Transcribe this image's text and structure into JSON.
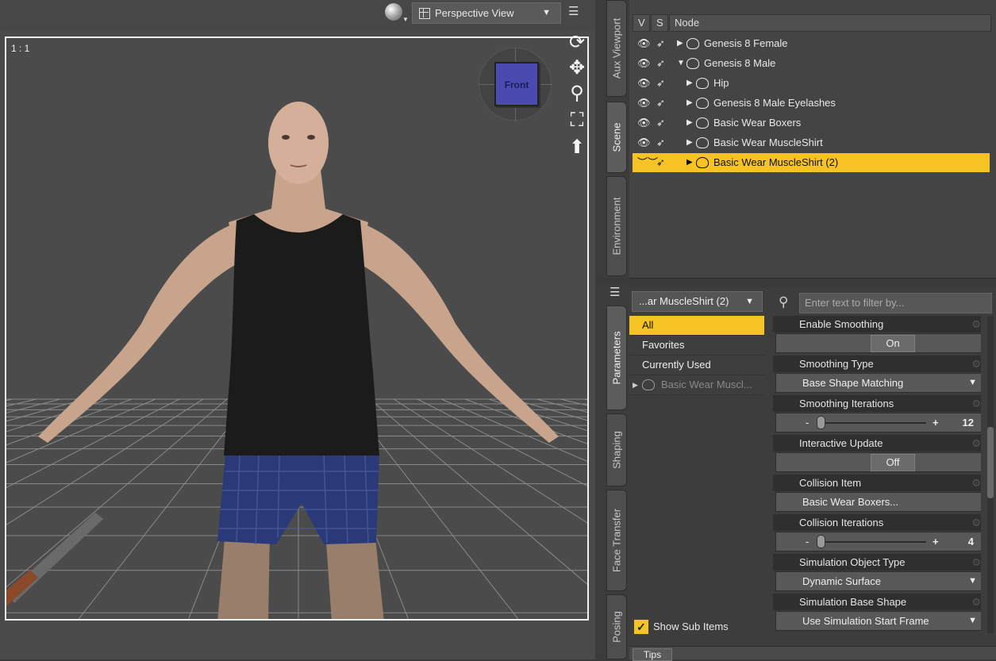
{
  "viewport": {
    "view_label": "Perspective View",
    "ratio_label": "1 : 1",
    "navcube_face": "Front",
    "tools": [
      "orbit-icon",
      "pan-icon",
      "zoom-icon",
      "frame-icon",
      "up-arrow-icon"
    ]
  },
  "side_tabs_top": [
    "Aux Viewport",
    "Scene",
    "Environment"
  ],
  "side_tabs_bottom": [
    "Parameters",
    "Shaping",
    "Face Transfer",
    "Posing"
  ],
  "scene": {
    "headers": {
      "v": "V",
      "s": "S",
      "node": "Node"
    },
    "nodes": [
      {
        "label": "Genesis 8 Female",
        "expander": "▶",
        "selected": false
      },
      {
        "label": "Genesis 8 Male",
        "expander": "▼",
        "selected": false
      },
      {
        "label": "Hip",
        "expander": "▶",
        "selected": false
      },
      {
        "label": "Genesis 8 Male Eyelashes",
        "expander": "▶",
        "selected": false
      },
      {
        "label": "Basic Wear Boxers",
        "expander": "▶",
        "selected": false
      },
      {
        "label": "Basic Wear MuscleShirt",
        "expander": "▶",
        "selected": false
      },
      {
        "label": "Basic Wear MuscleShirt (2)",
        "expander": "▶",
        "selected": true
      }
    ]
  },
  "params": {
    "node_select": "...ar MuscleShirt (2)",
    "search_placeholder": "Enter text to filter by...",
    "categories": [
      "All",
      "Favorites",
      "Currently Used",
      "Basic Wear Muscl..."
    ],
    "show_sub_items": "Show Sub Items",
    "properties": [
      {
        "title": "Enable Smoothing",
        "kind": "toggle",
        "value": "On"
      },
      {
        "title": "Smoothing Type",
        "kind": "dropdown",
        "value": "Base Shape Matching"
      },
      {
        "title": "Smoothing Iterations",
        "kind": "slider",
        "value": "12"
      },
      {
        "title": "Interactive Update",
        "kind": "toggle",
        "value": "Off"
      },
      {
        "title": "Collision Item",
        "kind": "button",
        "value": "Basic Wear Boxers..."
      },
      {
        "title": "Collision Iterations",
        "kind": "slider",
        "value": "4"
      },
      {
        "title": "Simulation Object Type",
        "kind": "dropdown",
        "value": "Dynamic Surface"
      },
      {
        "title": "Simulation Base Shape",
        "kind": "dropdown",
        "value": "Use Simulation Start Frame"
      }
    ]
  },
  "tips": "Tips",
  "colors": {
    "accent": "#f5c324",
    "panel": "#444444",
    "viewport": "#4b4b4b"
  }
}
